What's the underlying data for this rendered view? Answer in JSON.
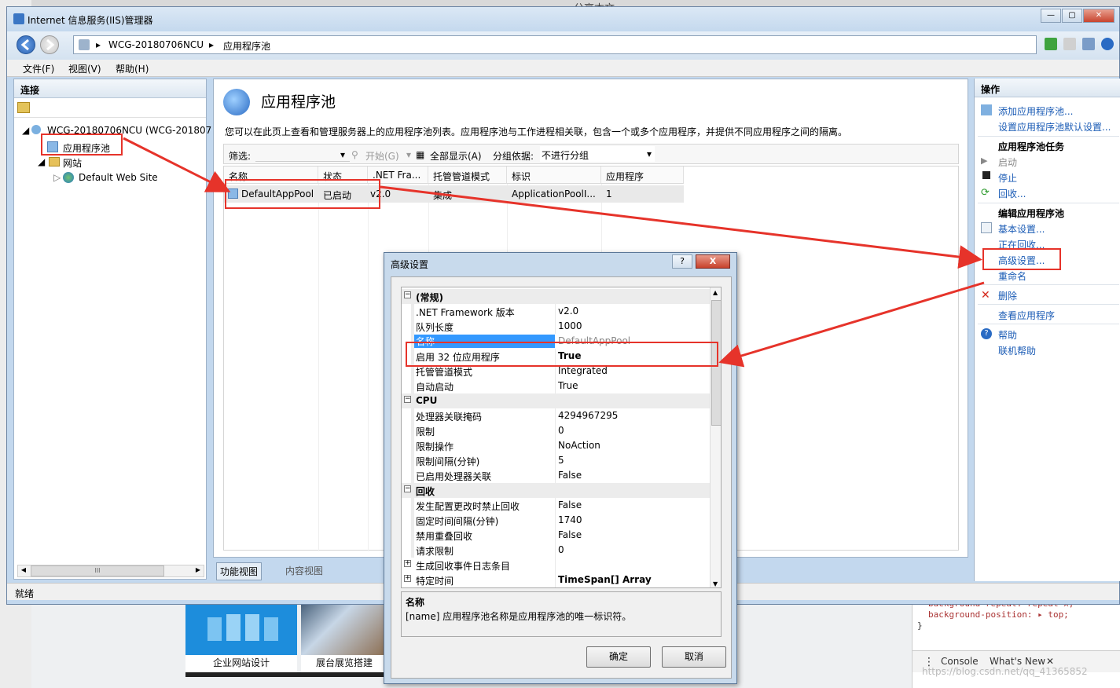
{
  "window": {
    "title": "Internet 信息服务(IIS)管理器",
    "controls": [
      "—",
      "▢",
      "✕"
    ]
  },
  "address": {
    "server": "WCG-20180706NCU",
    "page": "应用程序池"
  },
  "menu": [
    "文件(F)",
    "视图(V)",
    "帮助(H)"
  ],
  "connections": {
    "header": "连接",
    "server_node": "WCG-20180706NCU (WCG-201807",
    "app_pools_node": "应用程序池",
    "sites_node": "网站",
    "site_node": "Default Web Site",
    "scroll_marker": "III"
  },
  "status_text": "就绪",
  "center": {
    "title": "应用程序池",
    "description": "您可以在此页上查看和管理服务器上的应用程序池列表。应用程序池与工作进程相关联，包含一个或多个应用程序，并提供不同应用程序之间的隔离。",
    "filter_label": "筛选:",
    "start_label": "开始(G)",
    "show_all_label": "全部显示(A)",
    "group_label": "分组依据:",
    "group_value": "不进行分组",
    "columns": [
      "名称",
      "状态",
      ".NET Fra...",
      "托管管道模式",
      "标识",
      "应用程序"
    ],
    "row": {
      "name": "DefaultAppPool",
      "status": "已启动",
      "net": "v2.0",
      "pipeline": "集成",
      "identity": "ApplicationPoolI...",
      "apps": "1"
    },
    "tab_features": "功能视图",
    "tab_content": "内容视图"
  },
  "actions": {
    "header": "操作",
    "add_pool": "添加应用程序池...",
    "set_defaults": "设置应用程序池默认设置...",
    "tasks_header": "应用程序池任务",
    "start": "启动",
    "stop": "停止",
    "recycle": "回收...",
    "edit_header": "编辑应用程序池",
    "basic": "基本设置...",
    "recycling": "正在回收...",
    "advanced": "高级设置...",
    "rename": "重命名",
    "delete": "删除",
    "view_apps": "查看应用程序",
    "help": "帮助",
    "online_help": "联机帮助"
  },
  "dialog": {
    "title": "高级设置",
    "help_btn": "?",
    "close_btn": "X",
    "categories": {
      "general": "(常规)",
      "cpu": "CPU",
      "recycling": "回收"
    },
    "general_rows": [
      {
        "name": ".NET Framework 版本",
        "value": "v2.0"
      },
      {
        "name": "队列长度",
        "value": "1000"
      },
      {
        "name": "名称",
        "value": "DefaultAppPool"
      },
      {
        "name": "启用 32 位应用程序",
        "value": "True"
      },
      {
        "name": "托管管道模式",
        "value": "Integrated"
      },
      {
        "name": "自动启动",
        "value": "True"
      }
    ],
    "cpu_rows": [
      {
        "name": "处理器关联掩码",
        "value": "4294967295"
      },
      {
        "name": "限制",
        "value": "0"
      },
      {
        "name": "限制操作",
        "value": "NoAction"
      },
      {
        "name": "限制间隔(分钟)",
        "value": "5"
      },
      {
        "name": "已启用处理器关联",
        "value": "False"
      }
    ],
    "recycle_rows": [
      {
        "name": "发生配置更改时禁止回收",
        "value": "False"
      },
      {
        "name": "固定时间间隔(分钟)",
        "value": "1740"
      },
      {
        "name": "禁用重叠回收",
        "value": "False"
      },
      {
        "name": "请求限制",
        "value": "0"
      },
      {
        "name": "生成回收事件日志条目",
        "value": ""
      },
      {
        "name": "特定时间",
        "value": "TimeSpan[] Array"
      }
    ],
    "desc_title": "名称",
    "desc_text": "[name] 应用程序池名称是应用程序池的唯一标识符。",
    "ok": "确定",
    "cancel": "取消"
  },
  "background": {
    "thumb1_caption": "企业网站设计",
    "thumb2_caption": "展台展览搭建",
    "top_text": "分享本文",
    "code_line1": "background-repeat: repeat-x;",
    "code_line2": "background-position: ▸ top;",
    "brace": "}",
    "tab_console": "Console",
    "tab_whatsnew": "What's New",
    "watermark": "https://blog.csdn.net/qq_41365852"
  },
  "colors": {
    "annotation": "#e6332a",
    "link": "#1a5bb5",
    "selection": "#3399ff"
  }
}
